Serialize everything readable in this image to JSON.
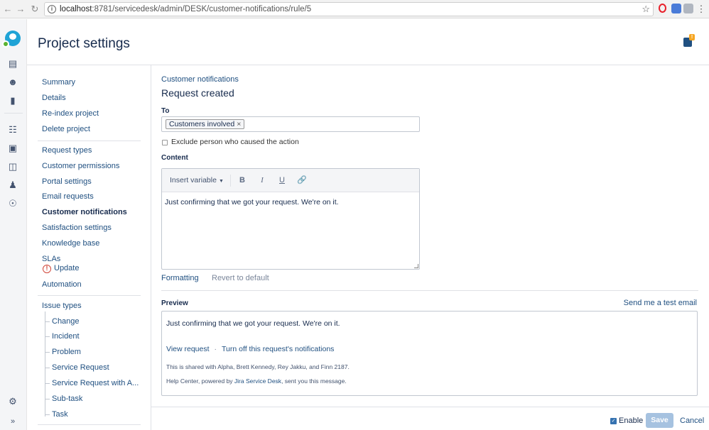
{
  "browser": {
    "url_host": "localhost",
    "url_path": ":8781/servicedesk/admin/DESK/customer-notifications/rule/5"
  },
  "header": {
    "title": "Project settings",
    "feedback_badge": "!"
  },
  "sidebar": {
    "group1": [
      "Summary",
      "Details",
      "Re-index project",
      "Delete project"
    ],
    "group2": [
      "Request types",
      "Customer permissions",
      "Portal settings",
      "Email requests",
      "Customer notifications",
      "Satisfaction settings",
      "Knowledge base",
      "SLAs",
      "Update",
      "Automation"
    ],
    "issue_types_label": "Issue types",
    "issue_types": [
      "Change",
      "Incident",
      "Problem",
      "Service Request",
      "Service Request with A...",
      "Sub-task",
      "Task"
    ],
    "active": "Customer notifications"
  },
  "main": {
    "breadcrumb": "Customer notifications",
    "title": "Request created",
    "to_label": "To",
    "to_chip": "Customers involved",
    "exclude_label": "Exclude person who caused the action",
    "content_label": "Content",
    "insert_variable": "Insert variable",
    "editor_text": "Just confirming that we got your request. We're on it.",
    "formatting_link": "Formatting",
    "revert_link": "Revert to default",
    "preview_label": "Preview",
    "test_email_link": "Send me a test email",
    "preview": {
      "text": "Just confirming that we got your request. We're on it.",
      "view_request": "View request",
      "turn_off": "Turn off this request's notifications",
      "shared_with": "This is shared with Alpha, Brett Kennedy, Rey Jakku, and Finn 2187.",
      "help_prefix": "Help Center, powered by ",
      "help_link": "Jira Service Desk",
      "help_suffix": ", sent you this message."
    },
    "enable_label": "Enable",
    "enable_checked": true,
    "save_label": "Save",
    "cancel_label": "Cancel"
  }
}
